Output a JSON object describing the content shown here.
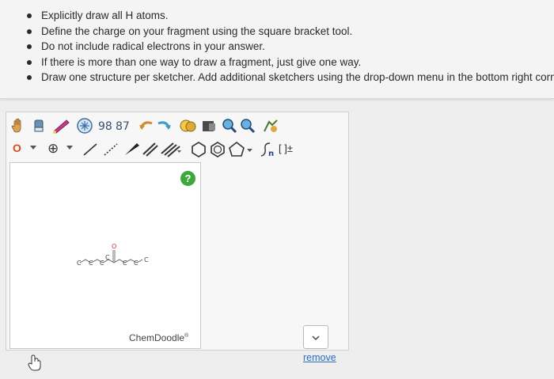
{
  "instructions": [
    "Explicitly draw all H atoms.",
    "Define the charge on your fragment using the square bracket tool.",
    "Do not include radical electrons in your answer.",
    "If there is more than one way to draw a fragment, just give one way.",
    "Draw one structure per sketcher. Add additional sketchers using the drop-down menu in the bottom right corn"
  ],
  "toolbar": {
    "row1_icons": [
      "hand-tool-icon",
      "eraser-icon",
      "lasso-icon",
      "template-ring-icon",
      "atom-map-icon",
      "undo-icon",
      "redo-icon",
      "copy-icon",
      "clear-icon",
      "zoom-in-icon",
      "zoom-out-icon",
      "clean-icon"
    ],
    "element_selector": "O",
    "charge_button": "⊕",
    "bracket_label": "[ ]±",
    "row2_icons": [
      "single-bond-icon",
      "dashed-bond-icon",
      "wedge-bond-icon",
      "double-bond-icon",
      "triple-bond-icon",
      "cyclohexane-icon",
      "benzene-icon",
      "pentagon-icon",
      "sgroup-icon",
      "bracket-icon"
    ]
  },
  "canvas": {
    "help": "?",
    "molecule_atoms": [
      "C",
      "C",
      "C",
      "C",
      "O",
      "C",
      "C",
      "C"
    ],
    "watermark": "ChemDoodle",
    "watermark_mark": "®"
  },
  "dropdown_value": "",
  "remove_label": "remove",
  "colors": {
    "help_green": "#3ea83e",
    "link_blue": "#2b6cc4",
    "element_red": "#d94a1e"
  }
}
